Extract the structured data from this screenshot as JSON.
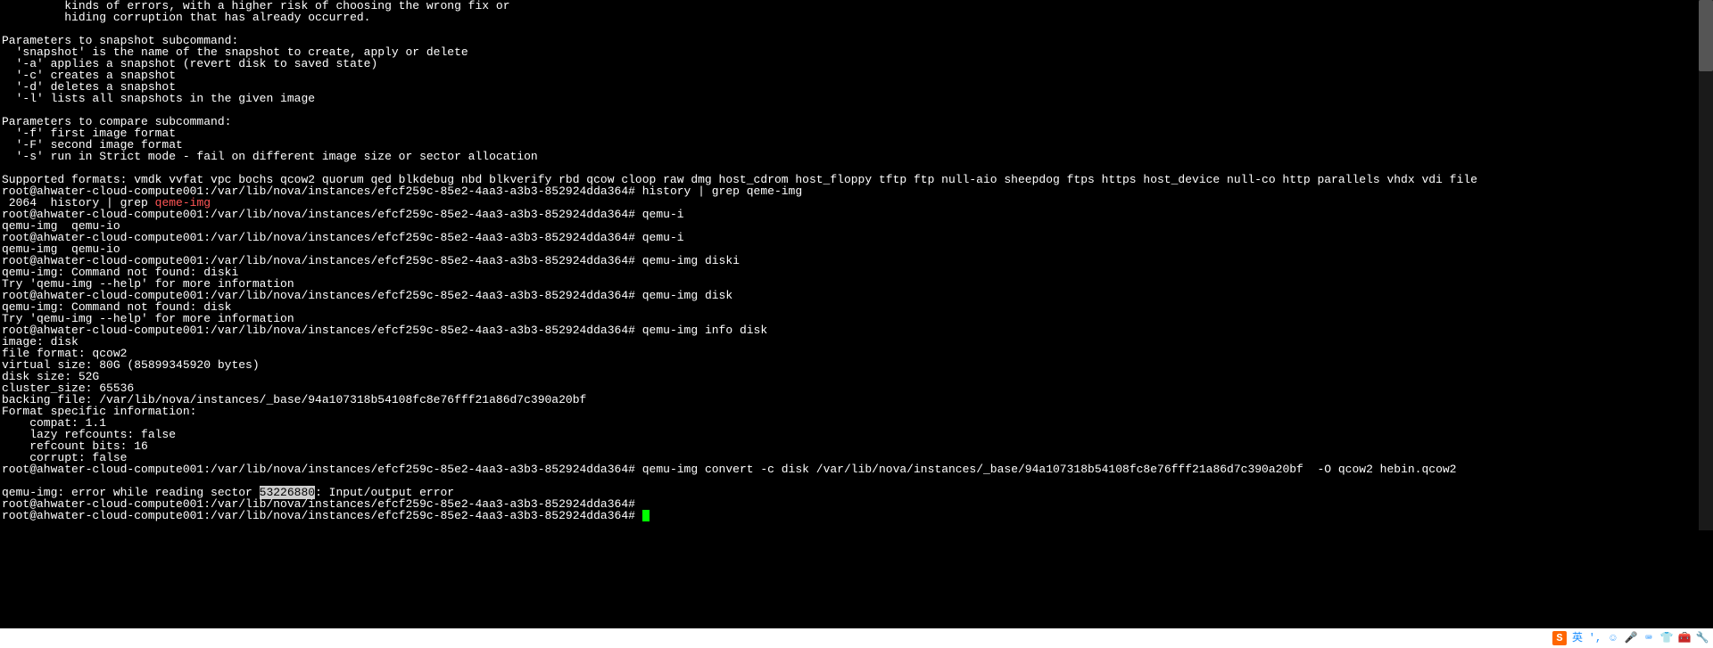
{
  "terminal": {
    "help_tail": [
      "         kinds of errors, with a higher risk of choosing the wrong fix or",
      "         hiding corruption that has already occurred.",
      "",
      "Parameters to snapshot subcommand:",
      "  'snapshot' is the name of the snapshot to create, apply or delete",
      "  '-a' applies a snapshot (revert disk to saved state)",
      "  '-c' creates a snapshot",
      "  '-d' deletes a snapshot",
      "  '-l' lists all snapshots in the given image",
      "",
      "Parameters to compare subcommand:",
      "  '-f' first image format",
      "  '-F' second image format",
      "  '-s' run in Strict mode - fail on different image size or sector allocation",
      "",
      "Supported formats: vmdk vvfat vpc bochs qcow2 quorum qed blkdebug nbd blkverify rbd qcow cloop raw dmg host_cdrom host_floppy tftp ftp null-aio sheepdog ftps https host_device null-co http parallels vhdx vdi file"
    ],
    "prompt": "root@ahwater-cloud-compute001:/var/lib/nova/instances/efcf259c-85e2-4aa3-a3b3-852924dda364#",
    "cmd_history_grep": "history | grep qeme-img",
    "history_line_prefix": " 2064  history | grep ",
    "history_line_hl": "qeme-img",
    "cmd_qemu_i": "qemu-i",
    "completion_line": "qemu-img  qemu-io",
    "cmd_qemu_img_diski": "qemu-img diski",
    "err_diski": "qemu-img: Command not found: diski",
    "try_help": "Try 'qemu-img --help' for more information",
    "cmd_qemu_img_disk": "qemu-img disk",
    "err_disk": "qemu-img: Command not found: disk",
    "cmd_info": "qemu-img info disk",
    "info_output": [
      "image: disk",
      "file format: qcow2",
      "virtual size: 80G (85899345920 bytes)",
      "disk size: 52G",
      "cluster_size: 65536",
      "backing file: /var/lib/nova/instances/_base/94a107318b54108fc8e76fff21a86d7c390a20bf",
      "Format specific information:",
      "    compat: 1.1",
      "    lazy refcounts: false",
      "    refcount bits: 16",
      "    corrupt: false"
    ],
    "cmd_convert": "qemu-img convert -c disk /var/lib/nova/instances/_base/94a107318b54108fc8e76fff21a86d7c390a20bf  -O qcow2 hebin.qcow2",
    "err_convert_prefix": "qemu-img: error while reading sector ",
    "err_convert_sector": "53226880",
    "err_convert_suffix": ": Input/output error"
  },
  "taskbar": {
    "sogou": "S",
    "lang": "英",
    "comma": "',"
  }
}
